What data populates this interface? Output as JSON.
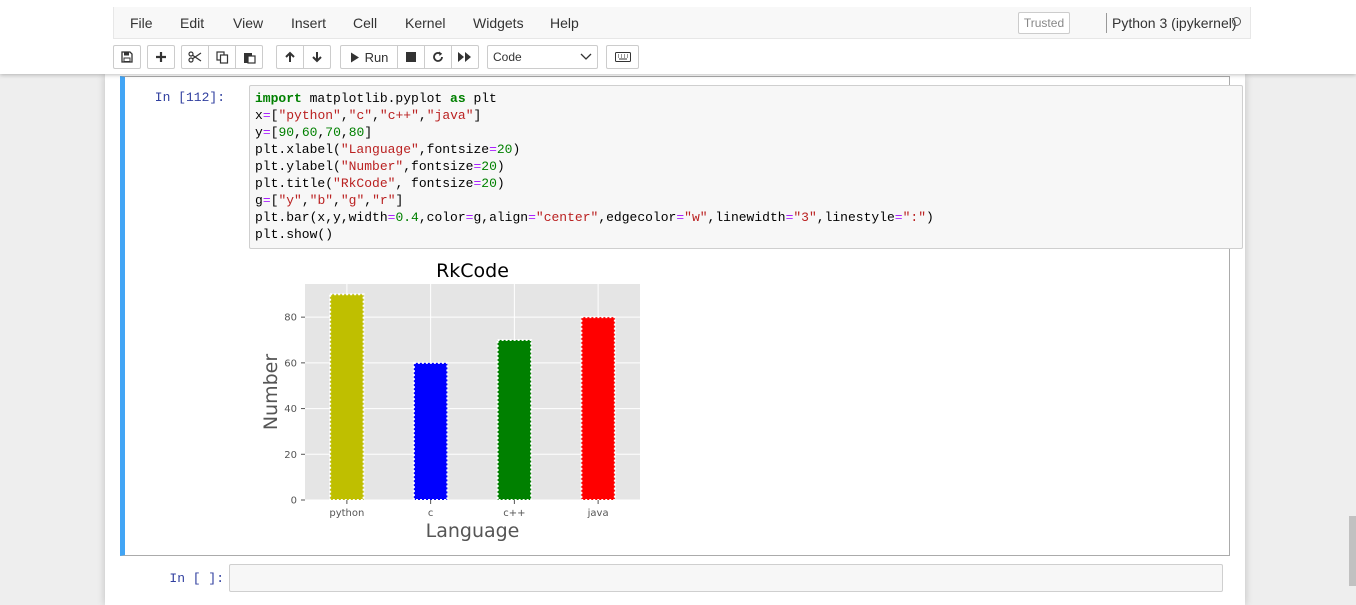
{
  "menu": {
    "items": [
      "File",
      "Edit",
      "View",
      "Insert",
      "Cell",
      "Kernel",
      "Widgets",
      "Help"
    ],
    "trusted": "Trusted",
    "kernel": "Python 3 (ipykernel)"
  },
  "toolbar": {
    "run_label": "Run",
    "cell_type": "Code",
    "icons": [
      "save-icon",
      "plus-icon",
      "scissors-icon",
      "copy-icon",
      "paste-icon",
      "arrow-up-icon",
      "arrow-down-icon",
      "play-icon",
      "stop-icon",
      "restart-icon",
      "fast-forward-icon",
      "keyboard-icon"
    ]
  },
  "cells": {
    "cell1": {
      "prompt": "In [112]:",
      "code": [
        "import matplotlib.pyplot as plt",
        "x=[\"python\",\"c\",\"c++\",\"java\"]",
        "y=[90,60,70,80]",
        "plt.xlabel(\"Language\",fontsize=20)",
        "plt.ylabel(\"Number\",fontsize=20)",
        "plt.title(\"RkCode\", fontsize=20)",
        "g=[\"y\",\"b\",\"g\",\"r\"]",
        "plt.bar(x,y,width=0.4,color=g,align=\"center\",edgecolor=\"w\",linewidth=\"3\",linestyle=\":\")",
        "plt.show()"
      ]
    },
    "cell2": {
      "prompt": "In [ ]:"
    }
  },
  "chart_data": {
    "type": "bar",
    "title": "RkCode",
    "xlabel": "Language",
    "ylabel": "Number",
    "categories": [
      "python",
      "c",
      "c++",
      "java"
    ],
    "values": [
      90,
      60,
      70,
      80
    ],
    "colors": [
      "#bfbf00",
      "#0000ff",
      "#008000",
      "#ff0000"
    ],
    "edgecolor": "#ffffff",
    "yticks": [
      0,
      20,
      40,
      60,
      80
    ],
    "ylim": [
      0,
      94.5
    ],
    "grid": true,
    "background": "#e5e5e5"
  }
}
